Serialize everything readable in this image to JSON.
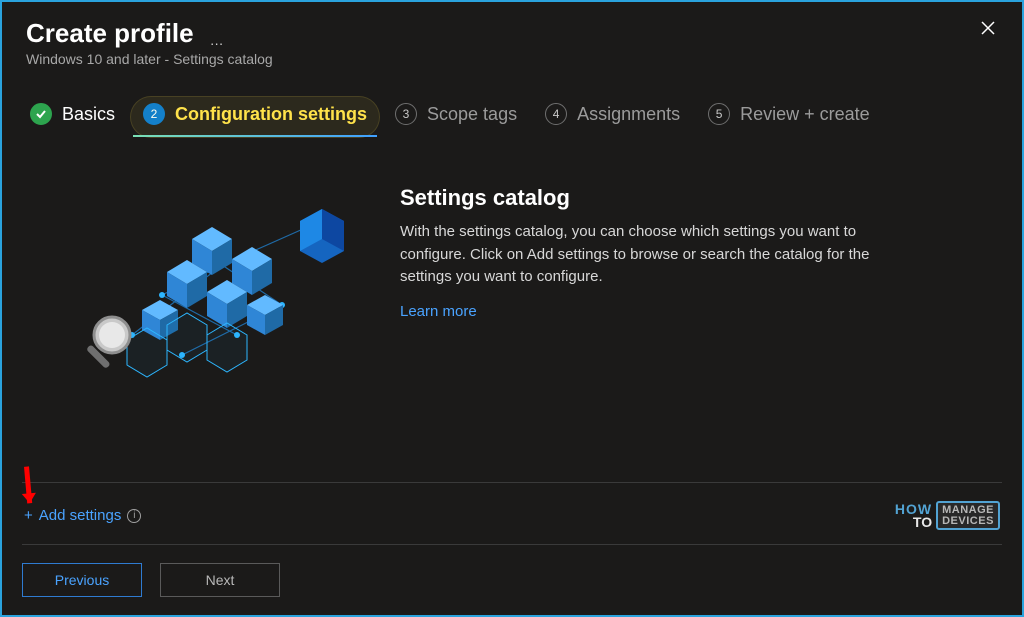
{
  "header": {
    "title": "Create profile",
    "subtitle": "Windows 10 and later - Settings catalog"
  },
  "steps": [
    {
      "num": "✓",
      "label": "Basics",
      "state": "done"
    },
    {
      "num": "2",
      "label": "Configuration settings",
      "state": "active"
    },
    {
      "num": "3",
      "label": "Scope tags",
      "state": "idle"
    },
    {
      "num": "4",
      "label": "Assignments",
      "state": "idle"
    },
    {
      "num": "5",
      "label": "Review + create",
      "state": "idle"
    }
  ],
  "content": {
    "heading": "Settings catalog",
    "body": "With the settings catalog, you can choose which settings you want to configure. Click on Add settings to browse or search the catalog for the settings you want to configure.",
    "learn_more": "Learn more"
  },
  "actions": {
    "add_settings": "Add settings"
  },
  "footer": {
    "previous": "Previous",
    "next": "Next"
  },
  "watermark": {
    "how": "HOW",
    "to": "TO",
    "line1": "MANAGE",
    "line2": "DEVICES"
  },
  "colors": {
    "accent": "#4aa3ff",
    "success": "#2da44e",
    "active_step": "#0078d4",
    "highlight_text": "#ffe24a"
  }
}
